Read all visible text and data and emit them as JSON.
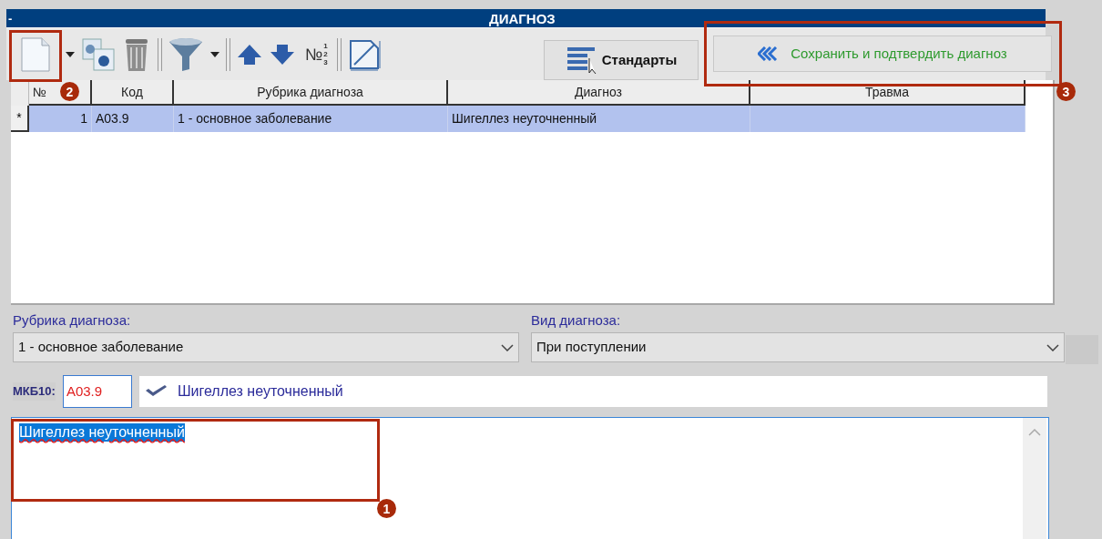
{
  "panel": {
    "collapse": "-",
    "title": "ДИАГНОЗ"
  },
  "toolbar": {
    "numbering": {
      "label": "№",
      "digits": [
        "1",
        "2",
        "3"
      ]
    }
  },
  "standards_button": {
    "label": "Стандарты"
  },
  "save_button": {
    "label": "Сохранить и подтвердить диагноз"
  },
  "table": {
    "columns": [
      "№",
      "Код",
      "Рубрика диагноза",
      "Диагноз",
      "Травма"
    ],
    "rows": [
      {
        "marker": "*",
        "selected": true,
        "number": "1",
        "code": "A03.9",
        "category": "1 - основное заболевание",
        "diagnosis": "Шигеллез неуточненный"
      }
    ]
  },
  "form": {
    "category": {
      "label": "Рубрика диагноза:",
      "value": "1 - основное заболевание"
    },
    "type": {
      "label": "Вид диагноза:",
      "value": "При поступлении"
    },
    "mkb": {
      "label": "МКБ10:",
      "code": "A03.9",
      "name": "Шигеллез неуточненный"
    },
    "notes": {
      "value": "Шигеллез неуточненный",
      "selected": true,
      "spelling_error": true
    }
  },
  "callouts": [
    {
      "label": "1"
    },
    {
      "label": "2"
    },
    {
      "label": "3"
    }
  ]
}
